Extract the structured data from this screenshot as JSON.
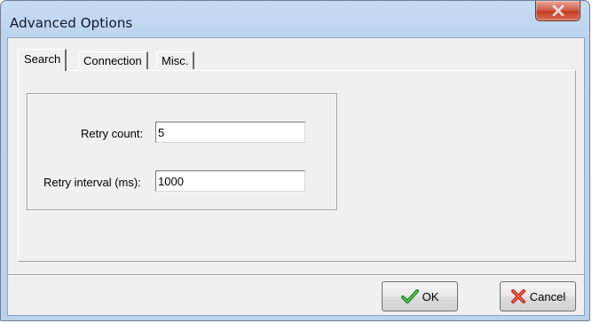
{
  "window": {
    "title": "Advanced Options"
  },
  "tabs": [
    {
      "label": "Search",
      "active": true
    },
    {
      "label": "Connection",
      "active": false
    },
    {
      "label": "Misc.",
      "active": false
    }
  ],
  "fields": {
    "retry_count": {
      "label": "Retry count:",
      "value": "5"
    },
    "retry_interval": {
      "label": "Retry interval (ms):",
      "value": "1000"
    }
  },
  "buttons": {
    "ok": {
      "label": "OK",
      "icon": "checkmark-icon",
      "icon_color": "#1f8a1f"
    },
    "cancel": {
      "label": "Cancel",
      "icon": "x-icon",
      "icon_color": "#cc2a1a"
    }
  },
  "colors": {
    "frame": "#bcd4ee",
    "close_button": "#c23b22",
    "client_background": "#f0f0f0"
  }
}
